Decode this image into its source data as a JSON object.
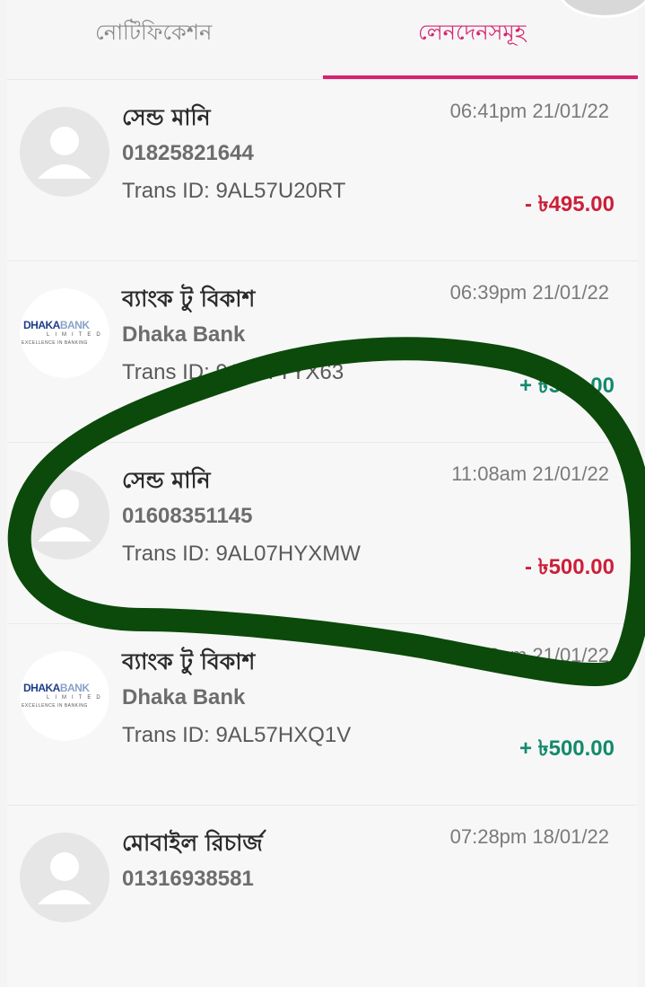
{
  "tabs": {
    "notifications": "নোটিফিকেশন",
    "transactions": "লেনদেনসমূহ",
    "active": "transactions"
  },
  "transactions": [
    {
      "title": "সেন্ড মানি",
      "party": "01825821644",
      "trans_id": "Trans ID: 9AL57U20RT",
      "time": "06:41pm 21/01/22",
      "amount": "- ৳495.00",
      "direction": "out",
      "icon": "user-placeholder-icon"
    },
    {
      "title": "ব্যাংক টু বিকাশ",
      "party": "Dhaka Bank",
      "trans_id": "Trans ID: 9AL77TYX63",
      "time": "06:39pm 21/01/22",
      "amount": "+ ৳500.00",
      "direction": "in",
      "icon": "dhaka-bank-logo"
    },
    {
      "title": "সেন্ড মানি",
      "party": "01608351145",
      "trans_id": "Trans ID: 9AL07HYXMW",
      "time": "11:08am 21/01/22",
      "amount": "- ৳500.00",
      "direction": "out",
      "icon": "user-placeholder-icon"
    },
    {
      "title": "ব্যাংক টু বিকাশ",
      "party": "Dhaka Bank",
      "trans_id": "Trans ID: 9AL57HXQ1V",
      "time": "11:03am 21/01/22",
      "amount": "+ ৳500.00",
      "direction": "in",
      "icon": "dhaka-bank-logo"
    },
    {
      "title": "মোবাইল রিচার্জ",
      "party": "01316938581",
      "trans_id": "",
      "time": "07:28pm 18/01/22",
      "amount": "",
      "direction": "out",
      "icon": "user-placeholder-icon"
    }
  ],
  "bank_logo": {
    "line1a": "DHAKA",
    "line1b": "BANK",
    "line2": "LIMITED",
    "line3": "EXCELLENCE IN BANKING"
  },
  "colors": {
    "accent": "#d6246e",
    "negative": "#cc1f3a",
    "positive": "#138a6c",
    "scribble": "#0b4a0b"
  }
}
